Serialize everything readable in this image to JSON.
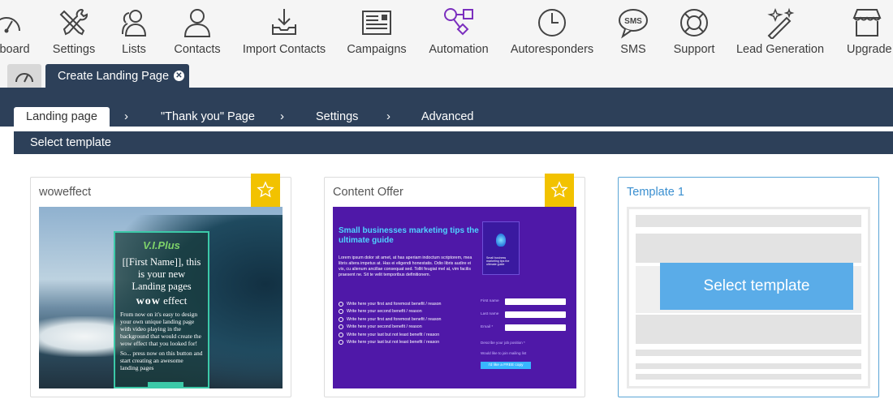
{
  "nav": {
    "items": [
      {
        "label": "Dashboard",
        "icon": "speedometer-icon"
      },
      {
        "label": "Settings",
        "icon": "tools-icon"
      },
      {
        "label": "Lists",
        "icon": "users-icon"
      },
      {
        "label": "Contacts",
        "icon": "user-icon"
      },
      {
        "label": "Import Contacts",
        "icon": "import-icon"
      },
      {
        "label": "Campaigns",
        "icon": "newsletter-icon"
      },
      {
        "label": "Automation",
        "icon": "workflow-icon"
      },
      {
        "label": "Autoresponders",
        "icon": "clock-icon"
      },
      {
        "label": "SMS",
        "icon": "sms-icon"
      },
      {
        "label": "Support",
        "icon": "lifebuoy-icon"
      },
      {
        "label": "Lead Generation",
        "icon": "magic-wand-icon"
      },
      {
        "label": "Upgrade",
        "icon": "store-icon"
      }
    ],
    "dashboard_visible_label": "board"
  },
  "tabs": {
    "active_tab": "Create Landing Page",
    "close_glyph": "✕"
  },
  "wizard": {
    "steps": [
      "Landing page",
      "\"Thank you\" Page",
      "Settings",
      "Advanced"
    ],
    "chevron": "›",
    "section_title": "Select template"
  },
  "templates": [
    {
      "title": "woweffect",
      "starred": true,
      "preview": {
        "logo": "V.I.Plus",
        "headline": "[[First Name]], this is your new Landing pages",
        "wow_word": "wow",
        "wow_suffix": "effect",
        "body1": "From now on it's easy to design your own unique landing page with video playing in the background that would create the wow effect that you looked for!",
        "body2": "So... press now on this button and start creating an awesome landing pages"
      }
    },
    {
      "title": "Content Offer",
      "starred": true,
      "preview": {
        "headline": "Small businesses marketing tips the ultimate guide",
        "body": "Lorem ipsum dolor sit amet, at has aperiam indoctum scriptorem, mea libris altera impetus at. Has ei eligendi honestatis. Odio libris audire ei vis, cu alienum ancillae consequat sed. Tollit feugiat mel at, vim facilis praesent ne. Sit te velit temporibus definitionem.",
        "bullets": [
          "Write here your first and foremost benefit / reason",
          "Write here your second benefit / reason",
          "Write here your first and foremost benefit / reason",
          "Write here your second benefit / reason",
          "Write here your last but not least benefit / reason",
          "Write here your last but not least benefit / reason"
        ],
        "book_title": "Small business marketing tips the ultimate guide",
        "form_labels": [
          "First name",
          "Last name",
          "Email *"
        ],
        "form_hint": "Describe your job position *",
        "checkbox_label": "Would like to join mailing list",
        "button": "I'd like a FREE copy"
      }
    },
    {
      "title": "Template 1",
      "starred": false,
      "selected": true,
      "button": "Select template"
    }
  ],
  "colors": {
    "navy": "#2d4059",
    "ribbon": "#f2c200",
    "accent_blue": "#5aace8",
    "automation_purple": "#7b2fbe"
  }
}
